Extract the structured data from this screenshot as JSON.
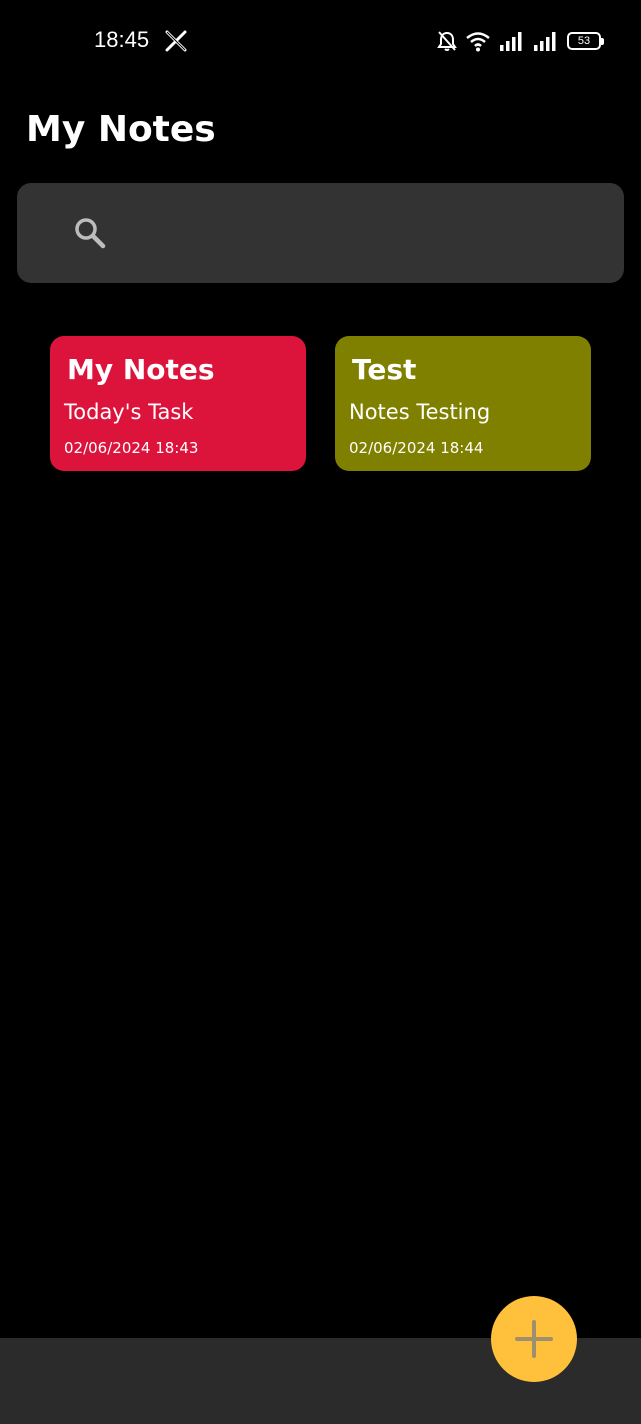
{
  "status_bar": {
    "time": "18:45",
    "battery_level": "53",
    "icons": [
      "x-logo-icon",
      "bell-off-icon",
      "wifi-icon",
      "signal-icon",
      "signal-icon",
      "battery-icon"
    ]
  },
  "header": {
    "title": "My Notes"
  },
  "search": {
    "placeholder": "",
    "value": "",
    "icon": "search-icon"
  },
  "notes": [
    {
      "title": "My Notes",
      "body": "Today's Task",
      "date": "02/06/2024 18:43",
      "color": "#dc143c"
    },
    {
      "title": "Test",
      "body": "Notes Testing",
      "date": "02/06/2024 18:44",
      "color": "#808000"
    }
  ],
  "fab": {
    "icon": "plus-icon",
    "color": "#ffc13b"
  },
  "colors": {
    "background": "#000000",
    "search_background": "#333333",
    "bottom_bar": "#2b2b2b"
  }
}
